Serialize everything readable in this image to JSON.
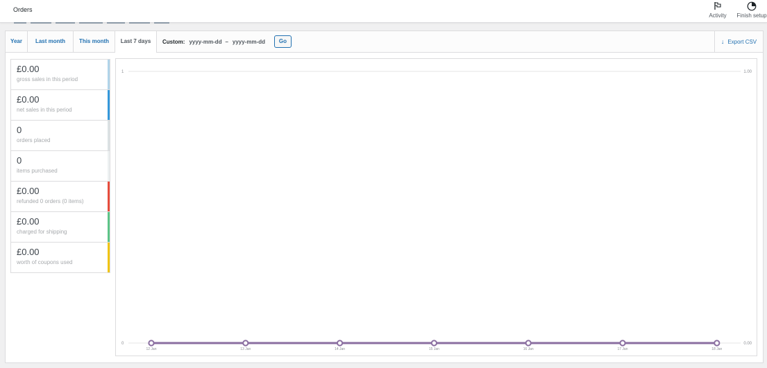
{
  "header": {
    "title": "Orders",
    "activity_label": "Activity",
    "finish_setup_label": "Finish setup"
  },
  "range": {
    "tabs": [
      {
        "label": "Year",
        "active": false
      },
      {
        "label": "Last month",
        "active": false
      },
      {
        "label": "This month",
        "active": false
      },
      {
        "label": "Last 7 days",
        "active": true
      }
    ],
    "custom_label": "Custom:",
    "start_placeholder": "yyyy-mm-dd",
    "separator": "–",
    "end_placeholder": "yyyy-mm-dd",
    "go_label": "Go",
    "export_label": "Export CSV"
  },
  "legend": [
    {
      "amount": "£0.00",
      "desc": "gross sales in this period",
      "color": "#b1d4ea"
    },
    {
      "amount": "£0.00",
      "desc": "net sales in this period",
      "color": "#3498db"
    },
    {
      "amount": "0",
      "desc": "orders placed",
      "color": "#dbe1e3"
    },
    {
      "amount": "0",
      "desc": "items purchased",
      "color": "#ecf0f1"
    },
    {
      "amount": "£0.00",
      "desc": "refunded 0 orders (0 items)",
      "color": "#e74c3c"
    },
    {
      "amount": "£0.00",
      "desc": "charged for shipping",
      "color": "#5cc488"
    },
    {
      "amount": "£0.00",
      "desc": "worth of coupons used",
      "color": "#f1c40f"
    }
  ],
  "chart_data": {
    "type": "line",
    "categories": [
      "12 Jan",
      "13 Jan",
      "14 Jan",
      "15 Jan",
      "16 Jan",
      "17 Jan",
      "18 Jan"
    ],
    "series": [
      {
        "values": [
          0,
          0,
          0,
          0,
          0,
          0,
          0
        ],
        "color": "#8a6ea0"
      }
    ],
    "y_left_ticks": [
      "1",
      "0"
    ],
    "y_right_ticks": [
      "1.00",
      "0.00"
    ],
    "ylim": [
      0,
      1
    ],
    "grid": true
  }
}
